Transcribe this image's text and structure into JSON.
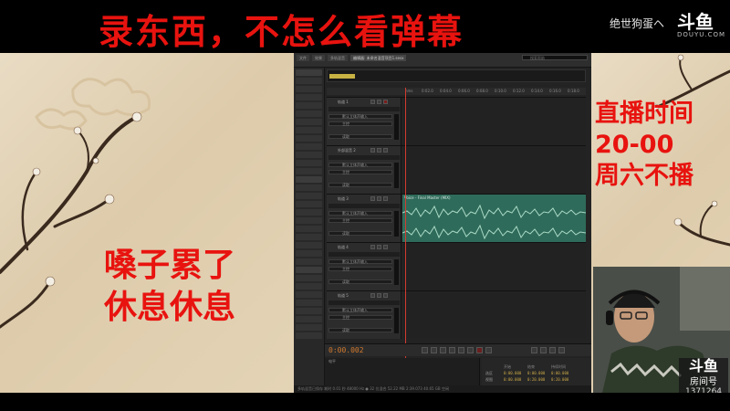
{
  "banner": {
    "title": "录东西，不怎么看弹幕",
    "streamer_name": "绝世狗蛋ヘ",
    "logo_mark": "斗鱼",
    "logo_sub": "DOUYU.COM"
  },
  "overlay": {
    "rest_line1": "嗓子累了",
    "rest_line2": "休息休息",
    "schedule_line1": "直播时间",
    "schedule_line2": "20-00",
    "schedule_line3": "周六不播"
  },
  "room": {
    "label": "房间号",
    "number": "1371264"
  },
  "app": {
    "tabs": [
      "文件",
      "效果",
      "多轨混音",
      "编辑器: 未命名混音项目1.sesx"
    ],
    "search_placeholder": "搜索帮助",
    "tracks": [
      {
        "name": "轨道 1",
        "input": "默认立体声输入",
        "output": "主控",
        "read": "读取"
      },
      {
        "name": "外部混音 2",
        "input": "默认立体声输入",
        "output": "主控",
        "read": "读取"
      },
      {
        "name": "轨道 3",
        "input": "默认立体声输入",
        "output": "主控",
        "read": "读取",
        "clip": "Voice - Final Master (MIX)"
      },
      {
        "name": "轨道 4",
        "input": "默认立体声输入",
        "output": "主控",
        "read": "读取"
      },
      {
        "name": "轨道 5",
        "input": "默认立体声输入",
        "output": "主控",
        "read": "读取"
      }
    ],
    "ruler_ticks": [
      "hms",
      "0:02.0",
      "0:04.0",
      "0:06.0",
      "0:08.0",
      "0:10.0",
      "0:12.0",
      "0:14.0",
      "0:16.0",
      "0:18.0",
      "0:20.0"
    ],
    "timecode": "0:00.002",
    "levels_label": "电平",
    "selection": {
      "headers": [
        "开始",
        "结束",
        "持续时间"
      ],
      "rows": [
        {
          "label": "选区",
          "start": "0:00.000",
          "end": "0:00.000",
          "duration": "0:00.000"
        },
        {
          "label": "视图",
          "start": "0:00.000",
          "end": "0:20.000",
          "duration": "0:20.000"
        }
      ]
    },
    "status_text": "多轨混音已保存 耗时 0.01 秒     48000 Hz ● 32 位混合     52.22 MB     2:39.073     40.65 GB 空闲"
  },
  "colors": {
    "accent_red": "#e8130f",
    "clip_green": "#2f6b5a",
    "timecode": "#d27a2e"
  }
}
